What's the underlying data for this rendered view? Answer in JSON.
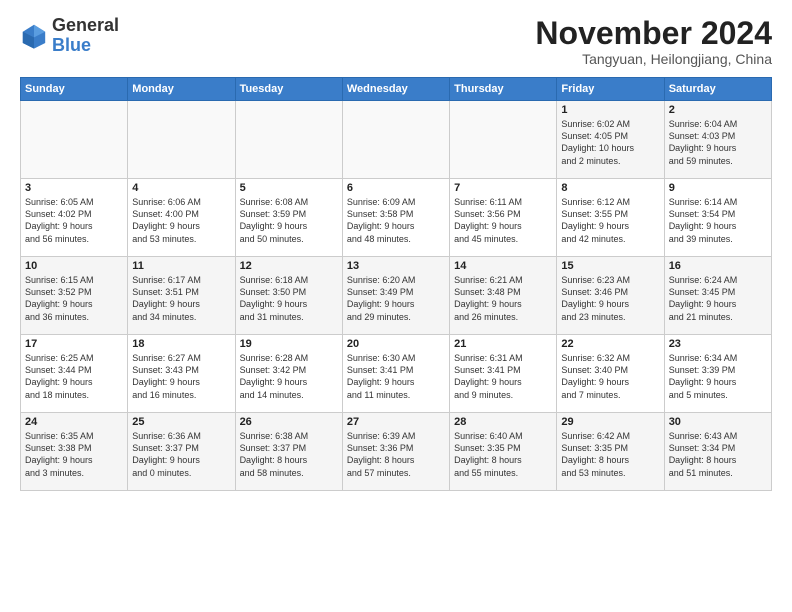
{
  "logo": {
    "general": "General",
    "blue": "Blue"
  },
  "title": "November 2024",
  "location": "Tangyuan, Heilongjiang, China",
  "weekdays": [
    "Sunday",
    "Monday",
    "Tuesday",
    "Wednesday",
    "Thursday",
    "Friday",
    "Saturday"
  ],
  "weeks": [
    [
      {
        "day": "",
        "content": ""
      },
      {
        "day": "",
        "content": ""
      },
      {
        "day": "",
        "content": ""
      },
      {
        "day": "",
        "content": ""
      },
      {
        "day": "",
        "content": ""
      },
      {
        "day": "1",
        "content": "Sunrise: 6:02 AM\nSunset: 4:05 PM\nDaylight: 10 hours\nand 2 minutes."
      },
      {
        "day": "2",
        "content": "Sunrise: 6:04 AM\nSunset: 4:03 PM\nDaylight: 9 hours\nand 59 minutes."
      }
    ],
    [
      {
        "day": "3",
        "content": "Sunrise: 6:05 AM\nSunset: 4:02 PM\nDaylight: 9 hours\nand 56 minutes."
      },
      {
        "day": "4",
        "content": "Sunrise: 6:06 AM\nSunset: 4:00 PM\nDaylight: 9 hours\nand 53 minutes."
      },
      {
        "day": "5",
        "content": "Sunrise: 6:08 AM\nSunset: 3:59 PM\nDaylight: 9 hours\nand 50 minutes."
      },
      {
        "day": "6",
        "content": "Sunrise: 6:09 AM\nSunset: 3:58 PM\nDaylight: 9 hours\nand 48 minutes."
      },
      {
        "day": "7",
        "content": "Sunrise: 6:11 AM\nSunset: 3:56 PM\nDaylight: 9 hours\nand 45 minutes."
      },
      {
        "day": "8",
        "content": "Sunrise: 6:12 AM\nSunset: 3:55 PM\nDaylight: 9 hours\nand 42 minutes."
      },
      {
        "day": "9",
        "content": "Sunrise: 6:14 AM\nSunset: 3:54 PM\nDaylight: 9 hours\nand 39 minutes."
      }
    ],
    [
      {
        "day": "10",
        "content": "Sunrise: 6:15 AM\nSunset: 3:52 PM\nDaylight: 9 hours\nand 36 minutes."
      },
      {
        "day": "11",
        "content": "Sunrise: 6:17 AM\nSunset: 3:51 PM\nDaylight: 9 hours\nand 34 minutes."
      },
      {
        "day": "12",
        "content": "Sunrise: 6:18 AM\nSunset: 3:50 PM\nDaylight: 9 hours\nand 31 minutes."
      },
      {
        "day": "13",
        "content": "Sunrise: 6:20 AM\nSunset: 3:49 PM\nDaylight: 9 hours\nand 29 minutes."
      },
      {
        "day": "14",
        "content": "Sunrise: 6:21 AM\nSunset: 3:48 PM\nDaylight: 9 hours\nand 26 minutes."
      },
      {
        "day": "15",
        "content": "Sunrise: 6:23 AM\nSunset: 3:46 PM\nDaylight: 9 hours\nand 23 minutes."
      },
      {
        "day": "16",
        "content": "Sunrise: 6:24 AM\nSunset: 3:45 PM\nDaylight: 9 hours\nand 21 minutes."
      }
    ],
    [
      {
        "day": "17",
        "content": "Sunrise: 6:25 AM\nSunset: 3:44 PM\nDaylight: 9 hours\nand 18 minutes."
      },
      {
        "day": "18",
        "content": "Sunrise: 6:27 AM\nSunset: 3:43 PM\nDaylight: 9 hours\nand 16 minutes."
      },
      {
        "day": "19",
        "content": "Sunrise: 6:28 AM\nSunset: 3:42 PM\nDaylight: 9 hours\nand 14 minutes."
      },
      {
        "day": "20",
        "content": "Sunrise: 6:30 AM\nSunset: 3:41 PM\nDaylight: 9 hours\nand 11 minutes."
      },
      {
        "day": "21",
        "content": "Sunrise: 6:31 AM\nSunset: 3:41 PM\nDaylight: 9 hours\nand 9 minutes."
      },
      {
        "day": "22",
        "content": "Sunrise: 6:32 AM\nSunset: 3:40 PM\nDaylight: 9 hours\nand 7 minutes."
      },
      {
        "day": "23",
        "content": "Sunrise: 6:34 AM\nSunset: 3:39 PM\nDaylight: 9 hours\nand 5 minutes."
      }
    ],
    [
      {
        "day": "24",
        "content": "Sunrise: 6:35 AM\nSunset: 3:38 PM\nDaylight: 9 hours\nand 3 minutes."
      },
      {
        "day": "25",
        "content": "Sunrise: 6:36 AM\nSunset: 3:37 PM\nDaylight: 9 hours\nand 0 minutes."
      },
      {
        "day": "26",
        "content": "Sunrise: 6:38 AM\nSunset: 3:37 PM\nDaylight: 8 hours\nand 58 minutes."
      },
      {
        "day": "27",
        "content": "Sunrise: 6:39 AM\nSunset: 3:36 PM\nDaylight: 8 hours\nand 57 minutes."
      },
      {
        "day": "28",
        "content": "Sunrise: 6:40 AM\nSunset: 3:35 PM\nDaylight: 8 hours\nand 55 minutes."
      },
      {
        "day": "29",
        "content": "Sunrise: 6:42 AM\nSunset: 3:35 PM\nDaylight: 8 hours\nand 53 minutes."
      },
      {
        "day": "30",
        "content": "Sunrise: 6:43 AM\nSunset: 3:34 PM\nDaylight: 8 hours\nand 51 minutes."
      }
    ]
  ]
}
